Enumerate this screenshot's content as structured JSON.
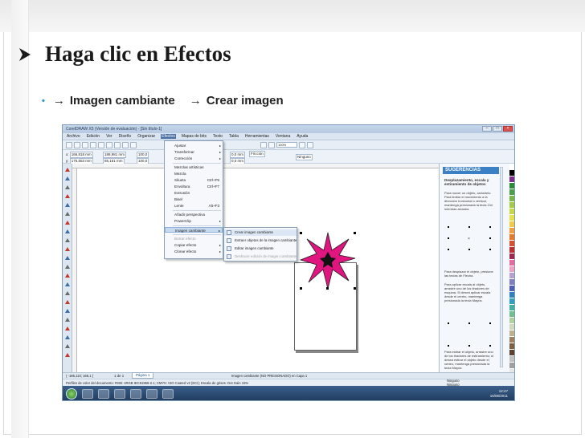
{
  "slide": {
    "title": "Haga clic en Efectos",
    "bullet_part1": "Imagen cambiante",
    "bullet_part2": "Crear imagen",
    "arrow_glyph": "→",
    "bullet_glyph": "•"
  },
  "app": {
    "window_title": "CorelDRAW X5 (Versión de evaluación) - [Sin título-1]",
    "menu": [
      "Archivo",
      "Edición",
      "Ver",
      "Diseño",
      "Organizar",
      "Efectos",
      "Mapas de bits",
      "Texto",
      "Tabla",
      "Herramientas",
      "Ventana",
      "Ayuda"
    ],
    "active_menu": "Efectos",
    "toolbar_zoom": "Ninguno",
    "propbar": {
      "x": "166,818 mm",
      "y": "175,553 mm",
      "w": "188,981 mm",
      "h": "85,161 mm",
      "sx": "100,0",
      "sy": "100,0",
      "angle": "0,0",
      "outline1": "0,0 mm",
      "outline2": "0,0 mm",
      "outline_style": "Ninguno",
      "preset": "Fricción"
    },
    "effects_menu": [
      {
        "label": "Ajustar",
        "arrow": "▸"
      },
      {
        "label": "Transformar",
        "arrow": "▸"
      },
      {
        "label": "Corrección",
        "arrow": "▸"
      },
      {
        "label": "Mezclas artísticas"
      },
      {
        "label": "Mezcla"
      },
      {
        "label": "Silueta",
        "shortcut": "Ctrl+F9"
      },
      {
        "label": "Envoltura",
        "shortcut": "Ctrl+F7"
      },
      {
        "label": "Extrusión"
      },
      {
        "label": "Bisel"
      },
      {
        "label": "Lente",
        "shortcut": "Alt+F3"
      },
      {
        "label": "Añadir perspectiva"
      },
      {
        "label": "PowerClip",
        "arrow": "▸"
      },
      {
        "label": "Imagen cambiante",
        "arrow": "▸"
      },
      {
        "label": "Borrar efecto"
      },
      {
        "label": "Copiar efecto",
        "arrow": "▸"
      },
      {
        "label": "Clonar efecto",
        "arrow": "▸"
      }
    ],
    "submenu": [
      "Crear imagen cambiante",
      "Extraer objetos de la imagen cambiante",
      "Editar imagen cambiante",
      "Deshacer edición de imagen cambiante"
    ],
    "docker": {
      "header": "SUGERENCIAS",
      "heading": "Desplazamiento, escala y estiramiento de objetos",
      "p1": "Para mover un objeto, arrástrelo. Para limitar el movimiento a la dirección horizontal o vertical, mantenga presionada la tecla Ctrl mientras arrastra.",
      "p2": "Para desplazar el objeto, presione las teclas de Flecha.",
      "p3": "Para aplicar escala al objeto, arrastre uno de los tiradores de esquina. Si desea aplicar escala desde el centro, mantenga presionada la tecla Mayús.",
      "p4": "Para estirar el objeto, arrastre uno de los tiradores de estiramiento; si desea estirar el objeto desde el centro, mantenga presionada la tecla Mayús."
    },
    "statusbar": {
      "pages": "1 de 1",
      "page_tab": "Página 1",
      "coords": "( -186,110; 166,1 )",
      "doc_info": "Perfiles de color del documento: RGB: sRGB IEC61966-2.1; CMYK: ISO Coated v2 (ECI); Escala de grises: Dot Gain 15%",
      "object_info": "Imagen cambiante (NO PRESIONADO) en Capa 1",
      "fill": "Ninguno",
      "outline": "Ninguno"
    },
    "taskbar": {
      "time": "12:47",
      "date": "16/06/2011"
    }
  },
  "colors": {
    "title_color": "#1a1a1a",
    "bullet_accent": "#2c8ac8",
    "star_fill": "#e0157f",
    "docker_header": "#3b7fc4"
  }
}
